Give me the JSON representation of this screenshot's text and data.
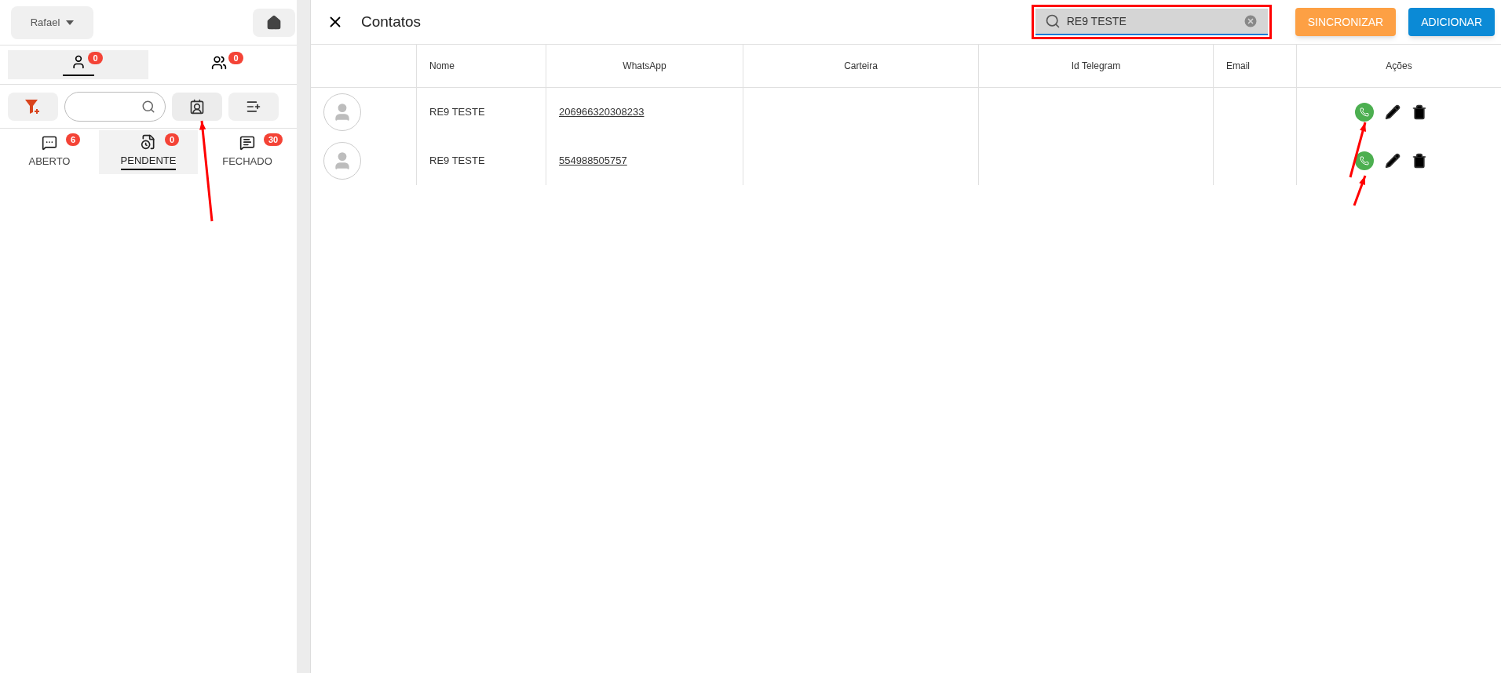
{
  "sidebar": {
    "user": {
      "label": "Rafael"
    },
    "queue_tabs": [
      {
        "kind": "single",
        "badge": "0",
        "selected": true
      },
      {
        "kind": "group",
        "badge": "0",
        "selected": false
      }
    ],
    "status_tabs": [
      {
        "kind": "open",
        "label": "ABERTO",
        "badge": "6",
        "selected": false
      },
      {
        "kind": "pending",
        "label": "PENDENTE",
        "badge": "0",
        "selected": true
      },
      {
        "kind": "closed",
        "label": "FECHADO",
        "badge": "30",
        "selected": false
      }
    ]
  },
  "dialog": {
    "title": "Contatos",
    "search": {
      "value": "RE9 TESTE"
    },
    "buttons": [
      {
        "kind": "sync",
        "label": "SINCRONIZAR"
      },
      {
        "kind": "add",
        "label": "ADICIONAR"
      }
    ],
    "table": {
      "columns": [
        "Nome",
        "WhatsApp",
        "Carteira",
        "Id Telegram",
        "Email",
        "Ações"
      ],
      "rows": [
        {
          "name": "RE9 TESTE",
          "whatsapp": "206966320308233"
        },
        {
          "name": "RE9 TESTE",
          "whatsapp": "554988505757"
        }
      ]
    }
  }
}
